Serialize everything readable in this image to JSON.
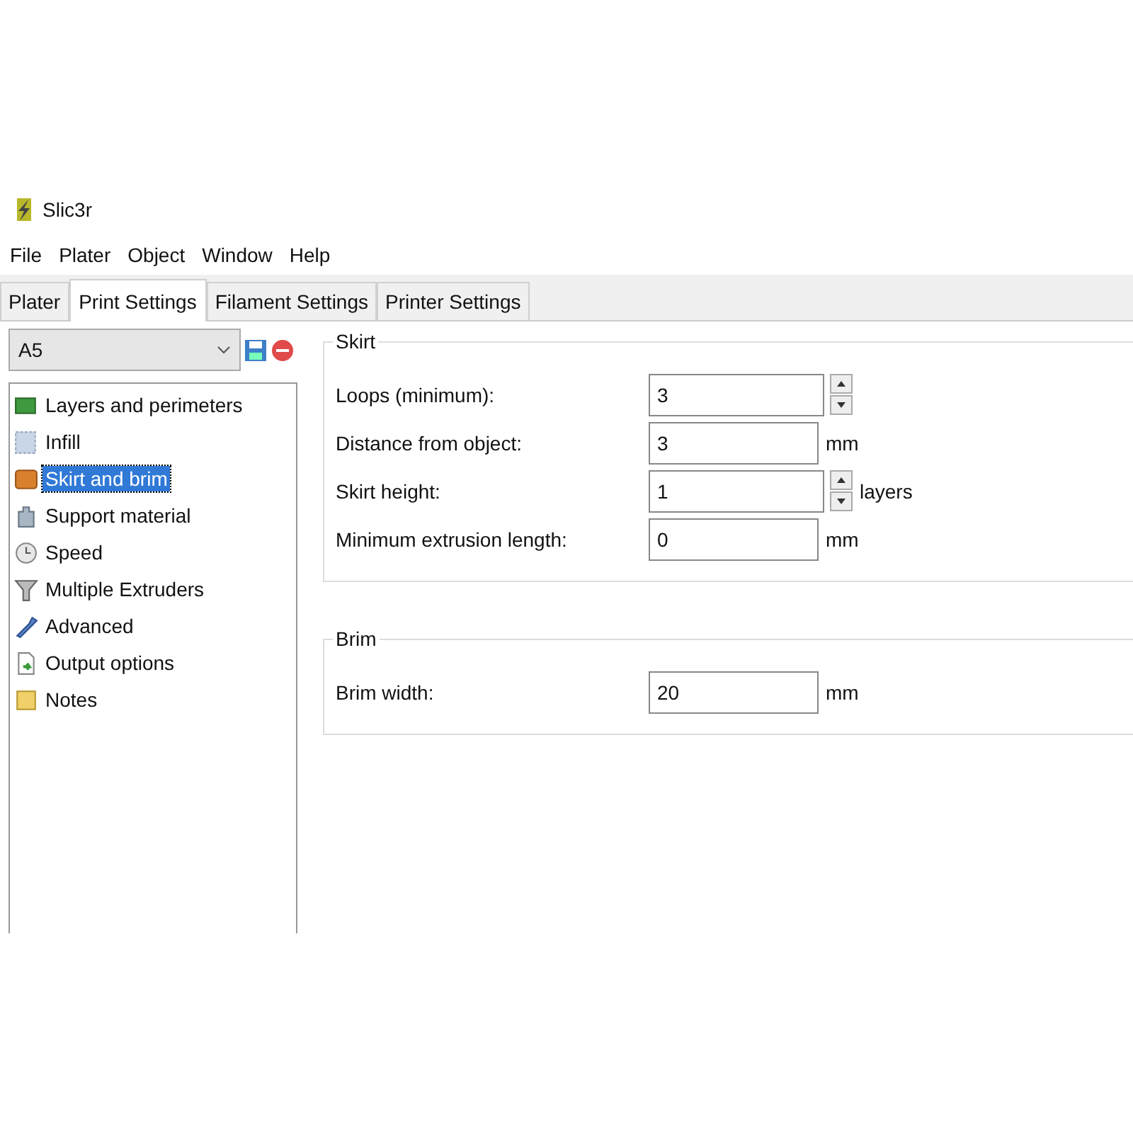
{
  "window": {
    "title": "Slic3r"
  },
  "menu": [
    "File",
    "Plater",
    "Object",
    "Window",
    "Help"
  ],
  "tabs": [
    {
      "label": "Plater",
      "selected": false
    },
    {
      "label": "Print Settings",
      "selected": true
    },
    {
      "label": "Filament Settings",
      "selected": false
    },
    {
      "label": "Printer Settings",
      "selected": false
    }
  ],
  "preset": {
    "value": "A5"
  },
  "pages": [
    {
      "label": "Layers and perimeters",
      "selected": false
    },
    {
      "label": "Infill",
      "selected": false
    },
    {
      "label": "Skirt and brim",
      "selected": true
    },
    {
      "label": "Support material",
      "selected": false
    },
    {
      "label": "Speed",
      "selected": false
    },
    {
      "label": "Multiple Extruders",
      "selected": false
    },
    {
      "label": "Advanced",
      "selected": false
    },
    {
      "label": "Output options",
      "selected": false
    },
    {
      "label": "Notes",
      "selected": false
    }
  ],
  "groups": [
    {
      "title": "Skirt",
      "fields": [
        {
          "label": "Loops (minimum):",
          "value": "3",
          "kind": "spin"
        },
        {
          "label": "Distance from object:",
          "value": "3",
          "kind": "plain",
          "unit": "mm"
        },
        {
          "label": "Skirt height:",
          "value": "1",
          "kind": "spin",
          "unit": "layers"
        },
        {
          "label": "Minimum extrusion length:",
          "value": "0",
          "kind": "plain",
          "unit": "mm"
        }
      ]
    },
    {
      "title": "Brim",
      "fields": [
        {
          "label": "Brim width:",
          "value": "20",
          "kind": "plain",
          "unit": "mm"
        }
      ]
    }
  ]
}
